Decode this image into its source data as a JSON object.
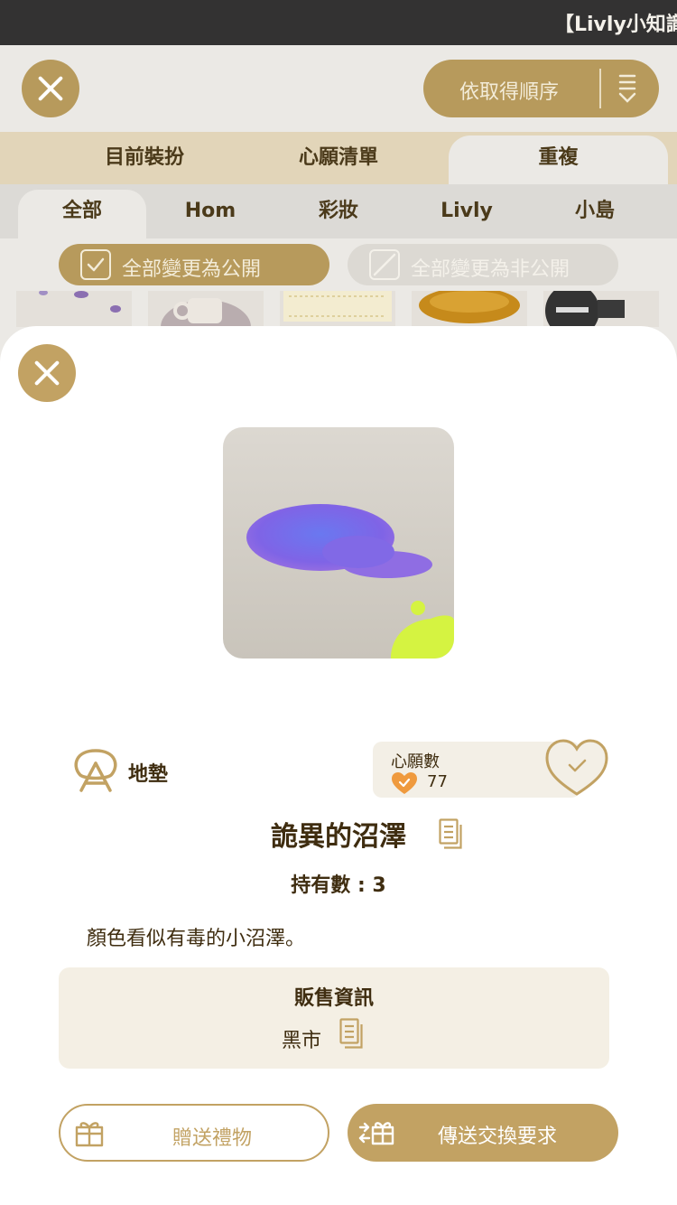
{
  "statusbar": {
    "title": "【Livly小知識"
  },
  "header": {
    "sort_label": "依取得順序"
  },
  "tabs_primary": [
    {
      "label": "目前裝扮"
    },
    {
      "label": "心願清單"
    },
    {
      "label": "重複"
    }
  ],
  "tabs_secondary": [
    {
      "label": "全部"
    },
    {
      "label": "Hom"
    },
    {
      "label": "彩妝"
    },
    {
      "label": "Livly"
    },
    {
      "label": "小島"
    }
  ],
  "bulk": {
    "public_label": "全部變更為公開",
    "private_label": "全部變更為非公開"
  },
  "item": {
    "category": "地墊",
    "wish_label": "心願數",
    "wish_count": "77",
    "name": "詭異的沼澤",
    "owned": "持有數 : 3",
    "description": "顏色看似有毒的小沼澤。",
    "sale_title": "販售資訊",
    "sale_value": "黑市"
  },
  "actions": {
    "gift_label": "贈送禮物",
    "trade_label": "傳送交換要求"
  },
  "colors": {
    "gold": "#c2a263",
    "gold_muted": "#b79a5c",
    "text": "#3f2d10",
    "heart_orange": "#ef9a3e"
  }
}
